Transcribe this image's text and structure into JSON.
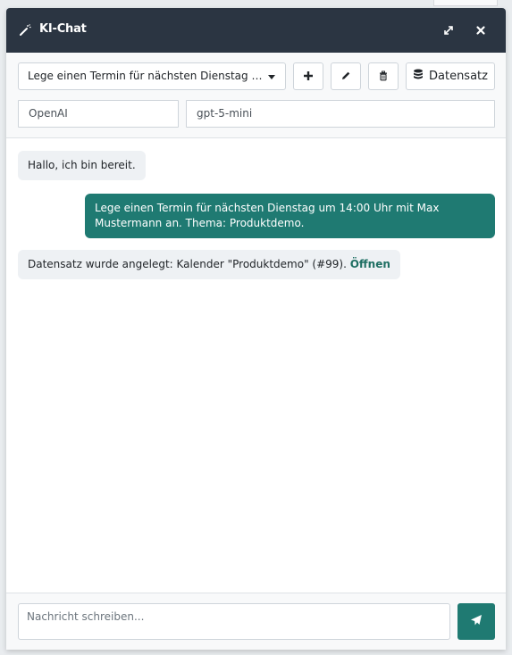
{
  "window": {
    "title": "KI-Chat",
    "title_icon": "magic-wand-icon",
    "expand_icon": "expand-icon",
    "close_icon": "close-icon"
  },
  "toolbar": {
    "conversation_select": "Lege einen Termin für nächsten Dienstag um...",
    "add_icon": "plus-icon",
    "edit_icon": "pencil-icon",
    "delete_icon": "trash-icon",
    "dataset_icon": "database-icon",
    "dataset_label": "Datensatz",
    "provider": "OpenAI",
    "model": "gpt-5-mini"
  },
  "messages": [
    {
      "role": "assistant",
      "text": "Hallo, ich bin bereit."
    },
    {
      "role": "user",
      "text": "Lege einen Termin für nächsten Dienstag um 14:00 Uhr mit Max Mustermann an. Thema: Produktdemo."
    },
    {
      "role": "assistant",
      "text": "Datensatz wurde angelegt: Kalender \"Produktdemo\" (#99).",
      "link": "Öffnen"
    }
  ],
  "composer": {
    "placeholder": "Nachricht schreiben...",
    "send_icon": "paper-plane-icon"
  },
  "colors": {
    "titlebar": "#2b3542",
    "accent": "#1f7a72",
    "bot_bubble": "#eef1f4"
  }
}
